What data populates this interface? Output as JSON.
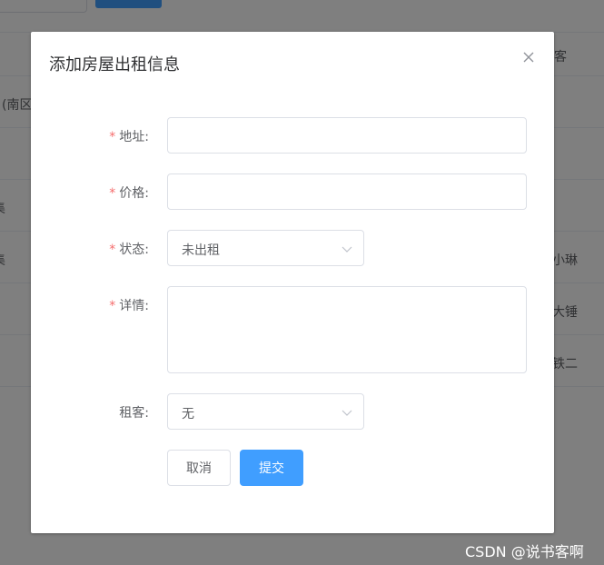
{
  "background": {
    "fragments": [
      "(南区",
      "客",
      "小琳",
      "大锤",
      "铁二",
      "集",
      "集"
    ]
  },
  "dialog": {
    "title": "添加房屋出租信息",
    "required_mark": "*",
    "fields": {
      "address": {
        "label": "地址:",
        "value": ""
      },
      "price": {
        "label": "价格:",
        "value": ""
      },
      "status": {
        "label": "状态:",
        "value": "未出租"
      },
      "details": {
        "label": "详情:",
        "value": ""
      },
      "tenant": {
        "label": "租客:",
        "value": "无"
      }
    },
    "buttons": {
      "cancel": "取消",
      "submit": "提交"
    }
  },
  "watermark": "CSDN @说书客啊",
  "colors": {
    "primary": "#409eff",
    "required": "#f56c6c",
    "border": "#dcdfe6"
  },
  "icons": {
    "close": "close-icon",
    "select_arrow": "chevron-down-icon"
  }
}
